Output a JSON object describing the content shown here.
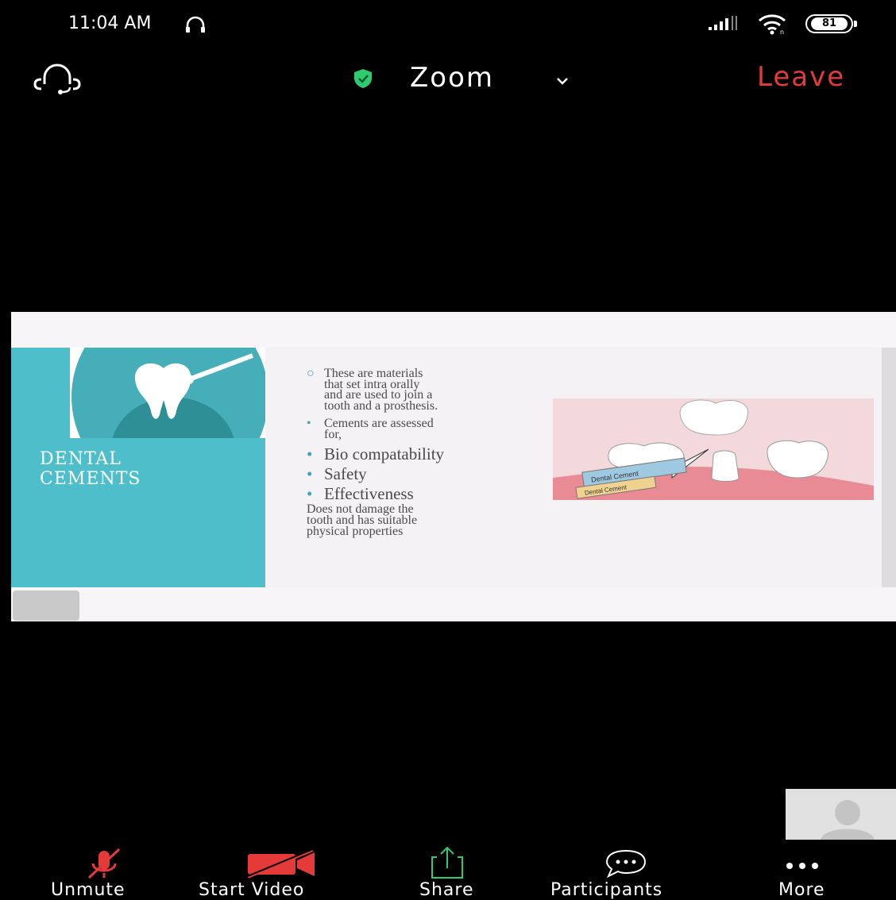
{
  "status_bar": {
    "time": "11:04 AM",
    "battery_level": "81",
    "icons": [
      "headset-icon",
      "signal-icon",
      "wifi-icon",
      "battery-icon"
    ]
  },
  "meeting": {
    "title": "Zoom",
    "leave_label": "Leave",
    "colors": {
      "leave": "#e43a3a",
      "security_shield": "#2ecc71"
    }
  },
  "slide": {
    "title_line1": "DENTAL",
    "title_line2": "CEMENTS",
    "bullet1": [
      "These are materials",
      "that set intra orally",
      "and are used to join a",
      "tooth and a prosthesis."
    ],
    "bullet2": [
      "Cements are assessed",
      "for,"
    ],
    "bullet3": "Bio compatability",
    "bullet4": "Safety",
    "bullet5": "Effectiveness",
    "note": [
      "Does not damage the",
      "tooth and has suitable",
      "physical properties"
    ],
    "image_labels": [
      "Dental Cement",
      "Dental Cement"
    ],
    "colors": {
      "teal": "#4fbecb",
      "bullet": "#3aa8b8"
    }
  },
  "toolbar": {
    "unmute": "Unmute",
    "start_video": "Start Video",
    "share": "Share",
    "participants": "Participants",
    "more": "More",
    "colors": {
      "muted": "#e43a3a",
      "share": "#2ecc71"
    }
  }
}
